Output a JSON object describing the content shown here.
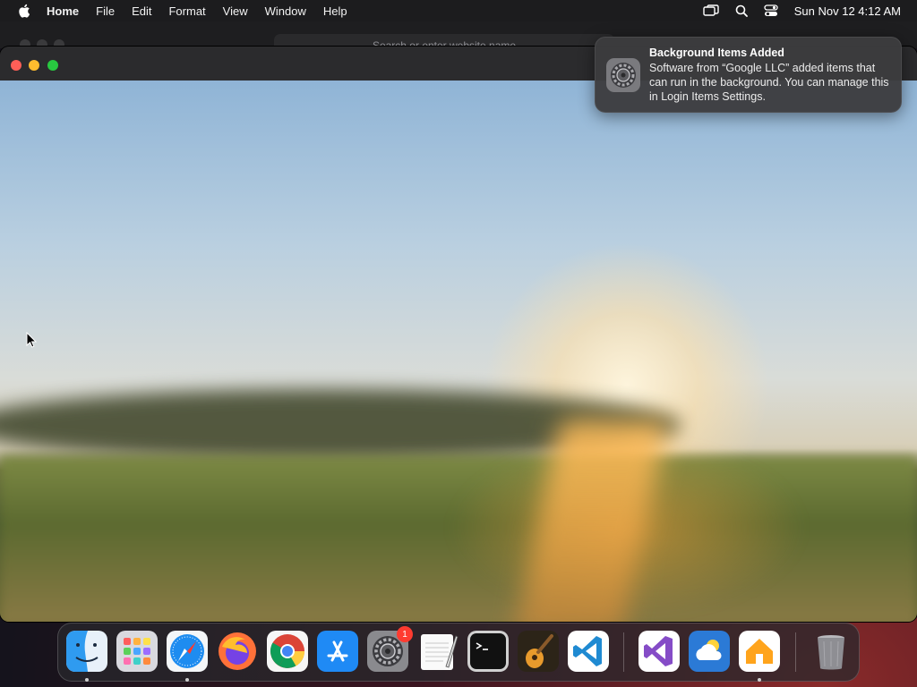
{
  "menubar": {
    "app_name": "Home",
    "menus": [
      "File",
      "Edit",
      "Format",
      "View",
      "Window",
      "Help"
    ],
    "status_icons": [
      "screen-mirroring-icon",
      "search-icon",
      "control-center-icon"
    ],
    "clock": "Sun Nov 12  4:12 AM"
  },
  "background_browser": {
    "address_placeholder": "Search or enter website name"
  },
  "notification": {
    "title": "Background Items Added",
    "body": "Software from “Google LLC” added items that can run in the background. You can manage this in Login Items Settings.",
    "icon": "system-settings-gear-icon"
  },
  "dock": {
    "apps": [
      {
        "name": "Finder",
        "icon": "finder-icon",
        "running": true
      },
      {
        "name": "Launchpad",
        "icon": "launchpad-icon",
        "running": false
      },
      {
        "name": "Safari",
        "icon": "safari-icon",
        "running": true
      },
      {
        "name": "Firefox",
        "icon": "firefox-icon",
        "running": false
      },
      {
        "name": "Google Chrome",
        "icon": "chrome-icon",
        "running": false
      },
      {
        "name": "App Store",
        "icon": "app-store-icon",
        "running": false
      },
      {
        "name": "System Settings",
        "icon": "system-settings-icon",
        "running": false,
        "badge": "1"
      },
      {
        "name": "TextEdit",
        "icon": "textedit-icon",
        "running": false
      },
      {
        "name": "Terminal",
        "icon": "terminal-icon",
        "running": false
      },
      {
        "name": "GarageBand",
        "icon": "garageband-icon",
        "running": false
      },
      {
        "name": "Visual Studio Code",
        "icon": "vscode-icon",
        "running": false
      },
      {
        "name": "Visual Studio",
        "icon": "visual-studio-icon",
        "running": false
      },
      {
        "name": "Weather",
        "icon": "weather-icon",
        "running": false
      },
      {
        "name": "Home",
        "icon": "home-icon",
        "running": true
      },
      {
        "name": "Trash",
        "icon": "trash-icon",
        "running": false
      }
    ]
  },
  "colors": {
    "close": "#ff5f57",
    "minimize": "#febc2e",
    "maximize": "#28c840",
    "badge": "#ff3b30"
  }
}
